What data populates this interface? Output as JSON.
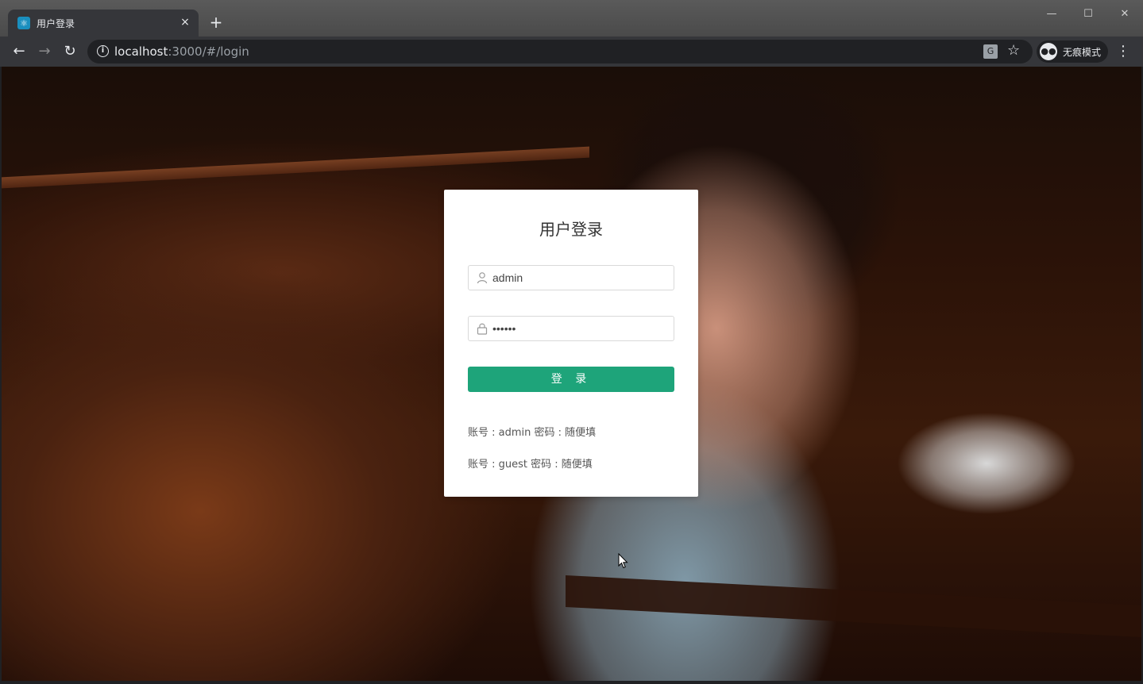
{
  "browser": {
    "tab_title": "用户登录",
    "tab_close": "×",
    "new_tab": "+",
    "window_controls": {
      "minimize": "—",
      "maximize": "☐",
      "close": "✕"
    },
    "nav": {
      "back": "←",
      "forward": "→",
      "reload": "↻"
    },
    "url_host": "localhost",
    "url_rest": ":3000/#/login",
    "profile_label": "无痕模式",
    "menu": "⋮",
    "icons": [
      "info-icon",
      "translate-icon",
      "star-icon",
      "incognito-icon",
      "menu-icon"
    ]
  },
  "login": {
    "title": "用户登录",
    "username_value": "admin",
    "password_value": "••••••",
    "submit_label": "登 录",
    "hints": [
      "账号 : admin 密码 : 随便填",
      "账号 : guest 密码 : 随便填"
    ],
    "accent_color": "#1ea47a"
  }
}
